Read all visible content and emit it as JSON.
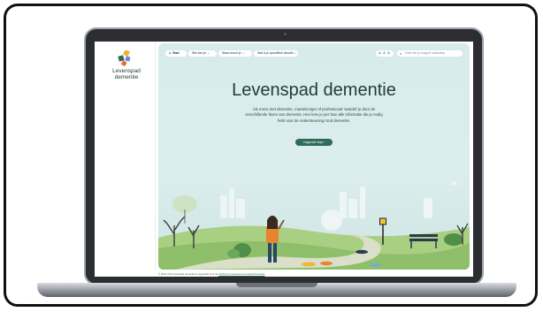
{
  "site": {
    "logo_name": "Levenspad dementie",
    "logo_colors": [
      "#f2b233",
      "#2f6b5a",
      "#e86b3a",
      "#5a8fd6"
    ]
  },
  "nav": {
    "start_label": "Start",
    "menu_items": [
      {
        "label": "Wie ben je ⌄"
      },
      {
        "label": "Waar woont je ⌄"
      },
      {
        "label": "Wat is je specifieke situatie ⌄"
      }
    ],
    "font_size_label": "A A A",
    "search_placeholder": "Zoek hier je vraag of onderwerp"
  },
  "hero": {
    "title": "Levenspad dementie",
    "description": "Als mens met dementie, mantelzorger of professional 'wandel' je door de verschillende fases van dementie. Hier lees je per fase alle informatie die je nodig hebt voor de ondersteuning rond dementie.",
    "cta_label": "Volgende stap  ›"
  },
  "footer": {
    "text": "© 2024 | Dit Levenspad dementie is opgesteld voor de ",
    "link": "Stichting Levenspad Levenspad Dementie"
  },
  "colors": {
    "accent": "#2f6b5a",
    "sky": "#d8ebec",
    "grass": "#8fbf6a",
    "path": "#d9dfc8"
  }
}
